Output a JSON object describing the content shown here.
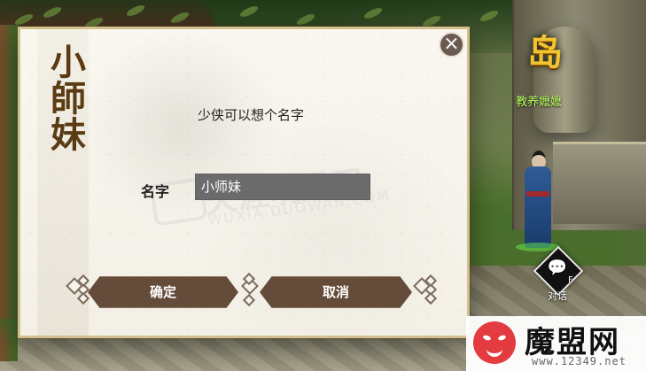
{
  "scene": {
    "npc_title": "岛",
    "npc_name": "教养嬷嬷",
    "talk_key": "F",
    "talk_label": "对话"
  },
  "dialog": {
    "side_title": "小師妹",
    "prompt": "少侠可以想个名字",
    "name_label": "名字",
    "name_value": "小师妹",
    "confirm": "确定",
    "cancel": "取消",
    "close_icon": "close-icon",
    "watermark_brand": "天涯明月刀",
    "watermark_url": "WUXIA.DUOWAN.COM"
  },
  "logo": {
    "text": "魔盟网",
    "url": "www.12349.net"
  },
  "colors": {
    "dialog_bg": "#f6f3ea",
    "button_brown": "#644b3a",
    "input_gray": "#6b6b6b",
    "npc_name_green": "#b7ff5e",
    "npc_title_gold": "#f1c530",
    "logo_red": "#e33b3f"
  }
}
